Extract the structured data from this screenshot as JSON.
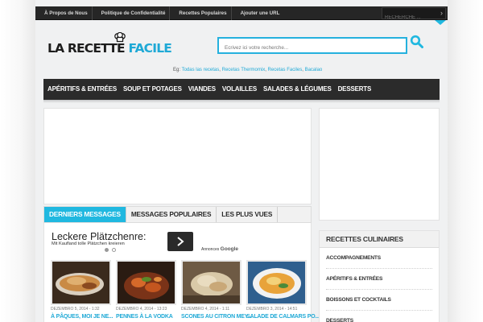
{
  "topbar": {
    "links": [
      "À Propos de Nous",
      "Politique de Confidentialité",
      "Recettes Populaires",
      "Ajouter une URL"
    ],
    "search_placeholder": "RECHERCHE ..."
  },
  "header": {
    "logo_part1": "LA RECETTE ",
    "logo_part2": "FACILE",
    "search_placeholder": "Ecrivez ici votre recherche...",
    "eg_label": "Eg:",
    "eg_links": [
      "Todas las recetas",
      "Recetas Thermomix",
      "Recetas Faciles",
      "Bacalao"
    ]
  },
  "mainnav": {
    "items": [
      "APÉRITIFS & ENTRÉES",
      "SOUP ET POTAGES",
      "VIANDES",
      "VOLAILLES",
      "SALADES & LÉGUMES",
      "DESSERTS"
    ]
  },
  "tabs": [
    "DERNIERS MESSAGES",
    "MESSAGES POPULAIRES",
    "LES PLUS VUES"
  ],
  "ad": {
    "title": "Leckere Plätzchenre:",
    "subtitle": "Mit Kaufland tolle Plätzchen kreieren",
    "label_prefix": "Annonces",
    "label_brand": "Google"
  },
  "posts": [
    {
      "date": "DEZEMBRO 5, 2014 - 1:32",
      "title": "À PÂQUES, MOI JE NE..."
    },
    {
      "date": "DEZEMBRO 4, 2014 - 13:23",
      "title": "PENNES À LA VODKA"
    },
    {
      "date": "DEZEMBRO 4, 2014 - 1:11",
      "title": "SCONES AU CITRON MEY..."
    },
    {
      "date": "DEZEMBRO 3, 2014 - 14:51",
      "title": "SALADE DE CALMARS PO..."
    }
  ],
  "categories": {
    "title": "RECETTES CULINAIRES",
    "items": [
      "ACCOMPAGNEMENTS",
      "APÉRITIFS & ENTRÉES",
      "BOISSONS ET COCKTAILS",
      "DESSERTS"
    ]
  },
  "colors": {
    "accent": "#20b8e0",
    "dark_nav": "#2b2b2b",
    "topbar": "#262626"
  }
}
